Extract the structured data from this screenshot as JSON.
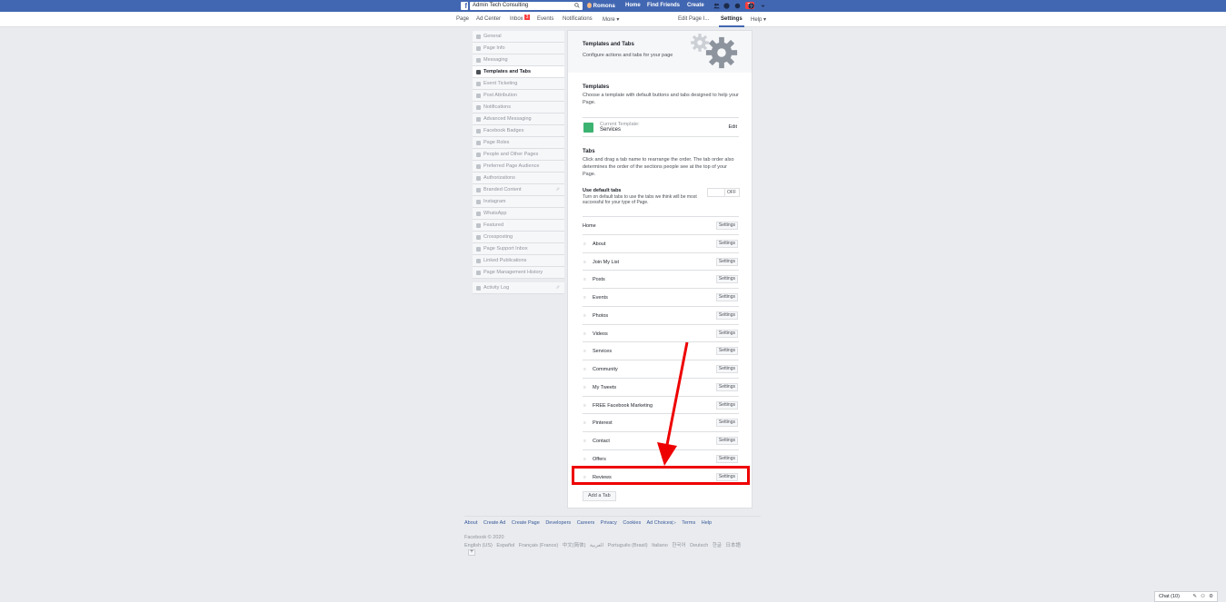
{
  "topbar": {
    "search_value": "Admin Tech Consulting",
    "user_name": "Romona",
    "nav": [
      "Home",
      "Find Friends",
      "Create"
    ],
    "notifications_count": "76"
  },
  "pagebar": {
    "left": [
      "Page",
      "Ad Center",
      "Inbox",
      "Events",
      "Notifications",
      "More ▾"
    ],
    "inbox_count": "3",
    "edit_page": "Edit Page I...",
    "settings": "Settings",
    "help": "Help ▾"
  },
  "sidebar": {
    "items": [
      "General",
      "Page Info",
      "Messaging",
      "Templates and Tabs",
      "Event Ticketing",
      "Post Attribution",
      "Notifications",
      "Advanced Messaging",
      "Facebook Badges",
      "Page Roles",
      "People and Other Pages",
      "Preferred Page Audience",
      "Authorizations",
      "Branded Content",
      "Instagram",
      "WhatsApp",
      "Featured",
      "Crossposting",
      "Page Support Inbox",
      "Linked Publications",
      "Page Management History"
    ],
    "activity_log": "Activity Log"
  },
  "main": {
    "header_title": "Templates and Tabs",
    "header_sub": "Configure actions and tabs for your page",
    "templates_title": "Templates",
    "templates_desc": "Choose a template with default buttons and tabs designed to help your Page.",
    "current_template_label": "Current Template:",
    "current_template_value": "Services",
    "edit_label": "Edit",
    "tabs_title": "Tabs",
    "tabs_desc": "Click and drag a tab name to rearrange the order. The tab order also determines the order of the sections people see at the top of your Page.",
    "default_tabs_label": "Use default tabs",
    "default_tabs_desc": "Turn on default tabs to use the tabs we think will be most successful for your type of Page.",
    "toggle_state": "OFF",
    "settings_label": "Settings",
    "tabs": [
      "Home",
      "About",
      "Join My List",
      "Posts",
      "Events",
      "Photos",
      "Videos",
      "Services",
      "Community",
      "My Tweets",
      "FREE Facebook Marketing",
      "Pinterest",
      "Contact",
      "Offers",
      "Reviews"
    ],
    "add_tab": "Add a Tab"
  },
  "footer": {
    "links": [
      "About",
      "Create Ad",
      "Create Page",
      "Developers",
      "Careers",
      "Privacy",
      "Cookies",
      "Ad Choices▷",
      "Terms",
      "Help"
    ],
    "copyright": "Facebook © 2020",
    "languages": [
      "English (US)",
      "Español",
      "Français (France)",
      "中文(简体)",
      "العربية",
      "Português (Brasil)",
      "Italiano",
      "한국어",
      "Deutsch",
      "한글",
      "日本語"
    ],
    "plus": "+"
  },
  "chat": {
    "label": "Chat (10)"
  },
  "colors": {
    "brand": "#4267b2",
    "highlight": "#ee0000",
    "badge": "#fa3e3e"
  }
}
